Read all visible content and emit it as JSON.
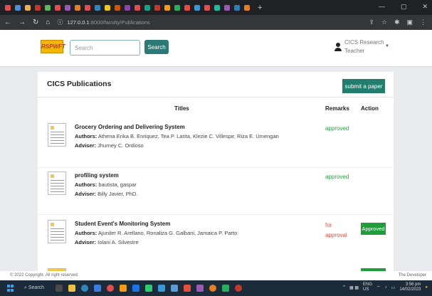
{
  "browser": {
    "url_host": "127.0.0.1",
    "url_rest": ":8000/faculty/Publications",
    "tab_colors": [
      "#e44d4d",
      "#4a90d9",
      "#f0ad4e",
      "#c0392b",
      "#5cb85c",
      "#e44d4d",
      "#9b59b6",
      "#e67e22",
      "#e44d4d",
      "#2e86c1",
      "#f1c40f",
      "#d35400",
      "#8e44ad",
      "#e44d4d",
      "#16a085",
      "#c0392b",
      "#f39c12",
      "#27ae60",
      "#e74c3c",
      "#3498db",
      "#e44d4d",
      "#1abc9c",
      "#9b59b6",
      "#2980b9",
      "#e67e22"
    ],
    "new_tab": "+",
    "window_controls": [
      "—",
      "▢",
      "✕"
    ]
  },
  "header": {
    "logo_text": "RSPWFT",
    "search_placeholder": "Search",
    "search_button": "Search",
    "user_name": "CICS Research",
    "user_role": "Teacher"
  },
  "page": {
    "title": "CICS Publications",
    "submit_button": "submit a paper",
    "columns": {
      "titles": "Titles",
      "remarks": "Remarks",
      "action": "Action"
    }
  },
  "publications": [
    {
      "title": "Grocery Ordering and Delivering System",
      "authors_label": "Authors:",
      "authors": "Athena Erika B. Enriquez, Tea P. Larita, Klezie C. Villespir, Riza E. Umengan",
      "adviser_label": "Adviser:",
      "adviser": "Jhurney C. Ordioso",
      "remark": "approved",
      "remark_status": "approved",
      "action": ""
    },
    {
      "title": "profiling system",
      "authors_label": "Authors:",
      "authors": "bautista, gaspar",
      "adviser_label": "Adviser:",
      "adviser": "Billy Javier, PhD.",
      "remark": "approved",
      "remark_status": "approved",
      "action": ""
    },
    {
      "title": "Student Event's Monitoring System",
      "authors_label": "Authors:",
      "authors": "Ajuniler R. Arellano, Ronaliza G. Galbani, Jamaica P. Parto",
      "adviser_label": "Adviser:",
      "adviser": "Iolani A. Silvestre",
      "remark_line1": "for",
      "remark_line2": "approval",
      "remark_status": "pending",
      "action": "Approved"
    }
  ],
  "footer": {
    "copyright": "© 2022 Copyright. All right reserved",
    "developer": "The Developer"
  },
  "taskbar": {
    "search_label": "Search",
    "lang": "ENG",
    "region": "US",
    "time": "3:56 pm",
    "date": "14/02/2023"
  },
  "colors": {
    "accent": "#2b7a78",
    "approved_text": "#2e9e44",
    "pending_text": "#d9534f",
    "approved_button": "#1f9d3a"
  }
}
